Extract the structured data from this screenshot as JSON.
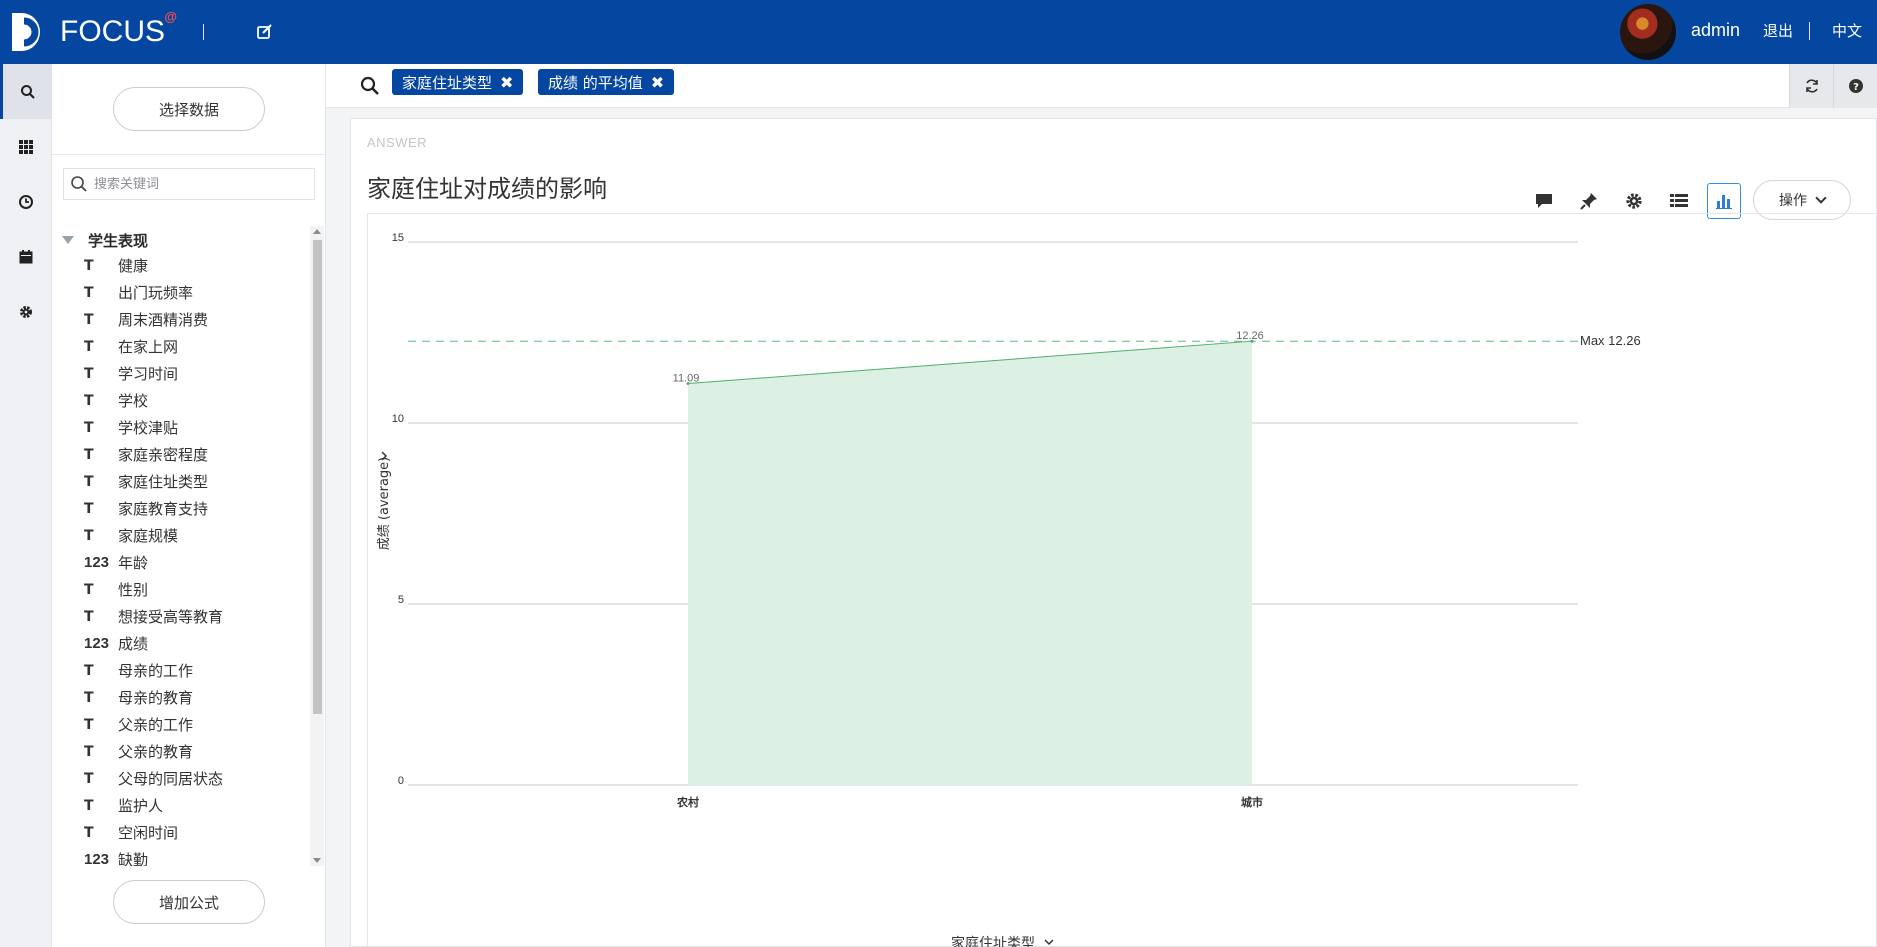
{
  "header": {
    "logo_text": "FOCUS",
    "logo_sup": "@",
    "user": "admin",
    "logout": "退出",
    "language": "中文",
    "brand_color": "#0546a0"
  },
  "rail": {
    "items": [
      {
        "icon": "search-icon",
        "active": true
      },
      {
        "icon": "apps-grid-icon",
        "active": false
      },
      {
        "icon": "history-clock-icon",
        "active": false
      },
      {
        "icon": "calendar-icon",
        "active": false
      },
      {
        "icon": "settings-gear-icon",
        "active": false
      }
    ]
  },
  "panel": {
    "select_data": "选择数据",
    "search_placeholder": "搜索关键词",
    "group": "学生表现",
    "fields": [
      {
        "type": "text",
        "label": "健康"
      },
      {
        "type": "text",
        "label": "出门玩频率"
      },
      {
        "type": "text",
        "label": "周末酒精消费"
      },
      {
        "type": "text",
        "label": "在家上网"
      },
      {
        "type": "text",
        "label": "学习时间"
      },
      {
        "type": "text",
        "label": "学校"
      },
      {
        "type": "text",
        "label": "学校津贴"
      },
      {
        "type": "text",
        "label": "家庭亲密程度"
      },
      {
        "type": "text",
        "label": "家庭住址类型"
      },
      {
        "type": "text",
        "label": "家庭教育支持"
      },
      {
        "type": "text",
        "label": "家庭规模"
      },
      {
        "type": "num",
        "label": "年龄"
      },
      {
        "type": "text",
        "label": "性别"
      },
      {
        "type": "text",
        "label": "想接受高等教育"
      },
      {
        "type": "num",
        "label": "成绩"
      },
      {
        "type": "text",
        "label": "母亲的工作"
      },
      {
        "type": "text",
        "label": "母亲的教育"
      },
      {
        "type": "text",
        "label": "父亲的工作"
      },
      {
        "type": "text",
        "label": "父亲的教育"
      },
      {
        "type": "text",
        "label": "父母的同居状态"
      },
      {
        "type": "text",
        "label": "监护人"
      },
      {
        "type": "text",
        "label": "空闲时间"
      },
      {
        "type": "num",
        "label": "缺勤"
      }
    ],
    "text_type_glyph": "T",
    "num_type_glyph": "123",
    "add_formula": "增加公式"
  },
  "query": {
    "tokens": [
      "家庭住址类型",
      "成绩 的平均值"
    ],
    "remove_glyph": "✖"
  },
  "answer": {
    "label": "ANSWER",
    "title": "家庭住址对成绩的影响",
    "ops": "操作",
    "tools": [
      "comment-icon",
      "pin-icon",
      "settings-gear-icon",
      "table-view-icon",
      "bar-chart-icon"
    ]
  },
  "chart_data": {
    "type": "area",
    "categories": [
      "农村",
      "城市"
    ],
    "series": [
      {
        "name": "",
        "values": [
          11.09,
          12.26
        ]
      }
    ],
    "data_labels": [
      "11.09",
      "12.26"
    ],
    "xlabel": "家庭住址类型",
    "ylabel": "成绩 (average)",
    "ylim": [
      0,
      15
    ],
    "yticks": [
      0,
      5,
      10,
      15
    ],
    "max_line": {
      "value": 12.26,
      "label": "Max 12.26"
    },
    "grid": true,
    "fill_color": "#dcf0e3",
    "line_color": "#4caf6e"
  }
}
